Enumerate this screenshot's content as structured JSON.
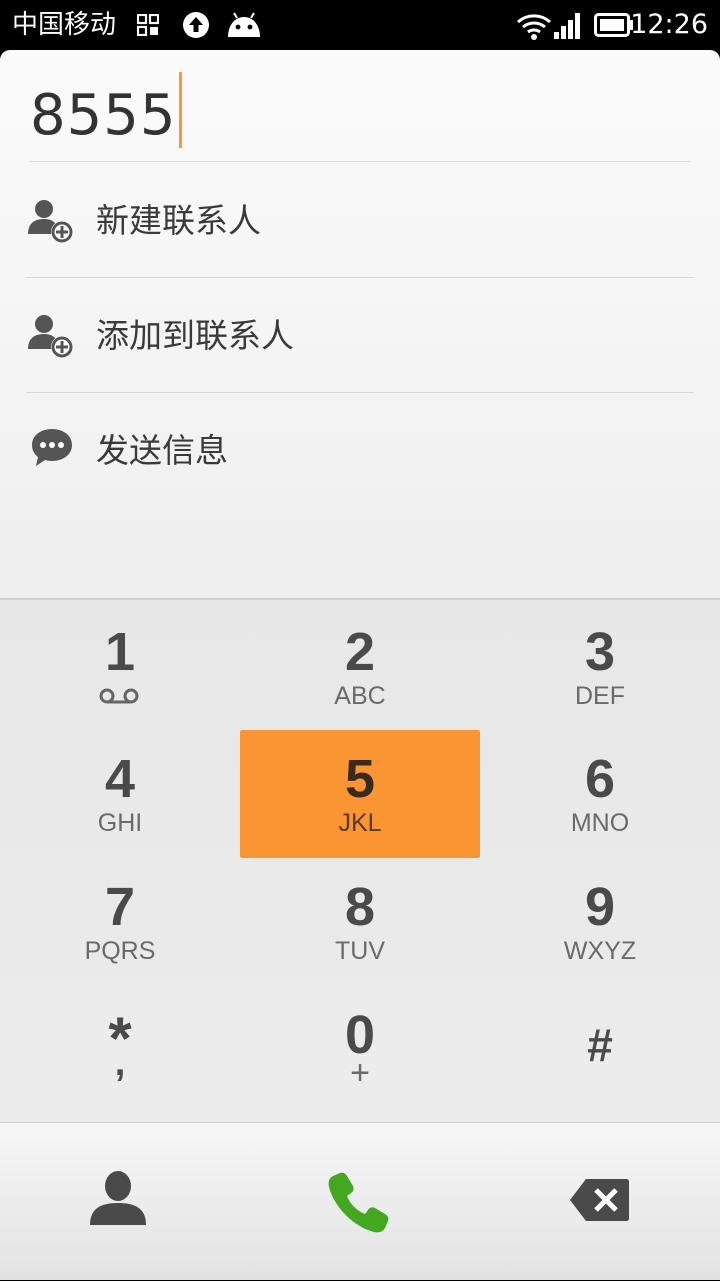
{
  "status_bar": {
    "carrier": "中国移动",
    "time": "12:26",
    "icons": [
      "apps-grid-icon",
      "upload-icon",
      "android-icon",
      "wifi-icon",
      "signal-icon",
      "battery-icon"
    ]
  },
  "dialer": {
    "input_value": "8555",
    "options": [
      {
        "label": "新建联系人",
        "icon": "add-contact-icon"
      },
      {
        "label": "添加到联系人",
        "icon": "add-contact-icon"
      },
      {
        "label": "发送信息",
        "icon": "message-bubble-icon"
      }
    ]
  },
  "keypad": {
    "keys": [
      {
        "digit": "1",
        "letters": "",
        "sub_icon": "voicemail-icon"
      },
      {
        "digit": "2",
        "letters": "ABC"
      },
      {
        "digit": "3",
        "letters": "DEF"
      },
      {
        "digit": "4",
        "letters": "GHI"
      },
      {
        "digit": "5",
        "letters": "JKL",
        "pressed": true
      },
      {
        "digit": "6",
        "letters": "MNO"
      },
      {
        "digit": "7",
        "letters": "PQRS"
      },
      {
        "digit": "8",
        "letters": "TUV"
      },
      {
        "digit": "9",
        "letters": "WXYZ"
      },
      {
        "digit": "*",
        "letters": ","
      },
      {
        "digit": "0",
        "letters": "+"
      },
      {
        "digit": "#",
        "letters": ""
      }
    ],
    "pressed_color": "#fa9534"
  },
  "action_bar": {
    "buttons": [
      "contacts-icon",
      "call-icon",
      "backspace-icon"
    ],
    "call_color": "#43a820"
  }
}
